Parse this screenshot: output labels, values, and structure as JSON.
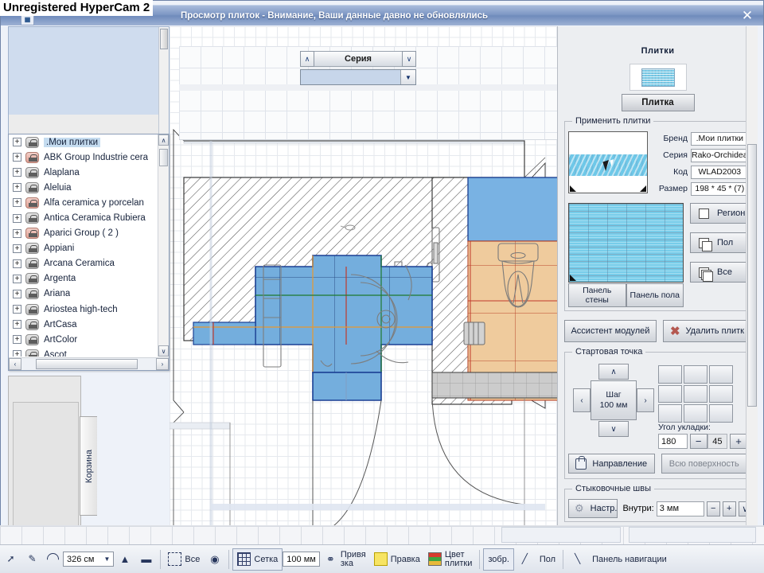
{
  "window": {
    "title": "Просмотр плиток - Внимание, Ваши данные давно не обновлялись",
    "close_label": "✕",
    "watermark": "Unregistered HyperCam 2",
    "app_icon": "tile-app-icon"
  },
  "series_combo": {
    "up_label": "∧",
    "down_label": "∨",
    "main_label": "Серия",
    "value": "",
    "arrow_label": "▼"
  },
  "tree": {
    "items": [
      {
        "label": ".Мои плитки",
        "icon": "folder-icon",
        "variant": "grey",
        "selected": true,
        "expander": "+"
      },
      {
        "label": "ABK Group Industrie cera",
        "icon": "folder-icon",
        "variant": "red",
        "selected": false,
        "expander": "+"
      },
      {
        "label": "Alaplana",
        "icon": "folder-icon",
        "variant": "grey",
        "selected": false,
        "expander": "+"
      },
      {
        "label": "Aleluia",
        "icon": "folder-icon",
        "variant": "grey",
        "selected": false,
        "expander": "+"
      },
      {
        "label": "Alfa ceramica y porcelan",
        "icon": "folder-icon",
        "variant": "red",
        "selected": false,
        "expander": "+"
      },
      {
        "label": "Antica Ceramica Rubiera",
        "icon": "folder-icon",
        "variant": "grey",
        "selected": false,
        "expander": "+"
      },
      {
        "label": "Aparici Group ( 2 )",
        "icon": "folder-icon",
        "variant": "red",
        "selected": false,
        "expander": "+"
      },
      {
        "label": "Appiani",
        "icon": "folder-icon",
        "variant": "grey",
        "selected": false,
        "expander": "+"
      },
      {
        "label": "Arcana Ceramica",
        "icon": "folder-icon",
        "variant": "grey",
        "selected": false,
        "expander": "+"
      },
      {
        "label": "Argenta",
        "icon": "folder-icon",
        "variant": "grey",
        "selected": false,
        "expander": "+"
      },
      {
        "label": "Ariana",
        "icon": "folder-icon",
        "variant": "grey",
        "selected": false,
        "expander": "+"
      },
      {
        "label": "Ariostea high-tech",
        "icon": "folder-icon",
        "variant": "grey",
        "selected": false,
        "expander": "+"
      },
      {
        "label": "ArtCasa",
        "icon": "folder-icon",
        "variant": "grey",
        "selected": false,
        "expander": "+"
      },
      {
        "label": "ArtColor",
        "icon": "folder-icon",
        "variant": "grey",
        "selected": false,
        "expander": "+"
      },
      {
        "label": "Ascot",
        "icon": "folder-icon",
        "variant": "grey",
        "selected": false,
        "expander": "+"
      }
    ],
    "scroll_up": "∧",
    "scroll_down": "∨",
    "scroll_left": "‹",
    "scroll_right": "›"
  },
  "left_dock": {
    "tab_label": "Корзина"
  },
  "right_panel": {
    "title": "Плитки",
    "tile_button": "Плитка",
    "apply_group": "Применить плитки",
    "fields": [
      {
        "label": "Бренд",
        "value": ".Мои плитки"
      },
      {
        "label": "Серия",
        "value": "Rako-Orchidea"
      },
      {
        "label": "Код",
        "value": "WLAD2003"
      },
      {
        "label": "Размер",
        "value": "198 * 45 * (7)"
      }
    ],
    "panel_buttons": [
      {
        "label": "Панель\nстены"
      },
      {
        "label": "Панель пола"
      }
    ],
    "scope_buttons": [
      {
        "label": "Регион",
        "icon": "single-square-icon"
      },
      {
        "label": "Пол",
        "icon": "two-squares-icon"
      },
      {
        "label": "Все",
        "icon": "three-squares-icon"
      }
    ],
    "assistant_button": "Ассистент модулей",
    "delete_button": "Удалить плитк",
    "delete_icon": "red-x-icon",
    "start_point": {
      "legend": "Стартовая точка",
      "up": "∧",
      "down": "∨",
      "left": "‹",
      "right": "›",
      "step_line1": "Шаг",
      "step_line2": "100 мм",
      "angle_label": "Угол укладки:",
      "angle_value": "180",
      "angle_step": "45",
      "minus": "−",
      "plus": "+",
      "direction_button": "Направление",
      "direction_icon": "lock-icon",
      "surface_button": "Всю поверхность"
    },
    "seams": {
      "legend": "Стыковочные швы",
      "settings_button": "Настр.",
      "settings_icon": "gear-icon",
      "inside_label": "Внутри:",
      "inside_value": "3 мм",
      "minus": "−",
      "plus": "+",
      "caret": "∨"
    }
  },
  "bottom_bar": {
    "items": [
      {
        "name": "pointer-tool",
        "icon": "cursor-icon",
        "label": ""
      },
      {
        "name": "measure-tool",
        "icon": "ruler-icon",
        "label": ""
      },
      {
        "name": "rotate-tool",
        "icon": "arc-icon",
        "label": ""
      },
      {
        "name": "zoom-value",
        "icon": "",
        "label": "326 см"
      },
      {
        "name": "zoom-in",
        "icon": "plus-icon",
        "label": ""
      },
      {
        "name": "zoom-out",
        "icon": "minus-icon",
        "label": ""
      },
      {
        "name": "select-all",
        "icon": "select-icon",
        "label": "Все"
      },
      {
        "name": "target-tool",
        "icon": "target-icon",
        "label": ""
      },
      {
        "name": "grid-toggle",
        "icon": "grid-icon",
        "label": "Сетка"
      },
      {
        "name": "grid-size",
        "icon": "",
        "label": "100 мм"
      },
      {
        "name": "snap-tool",
        "icon": "magnet-icon",
        "label": "Привя\nзка"
      },
      {
        "name": "edit-tool",
        "icon": "edit-icon",
        "label": "Правка"
      },
      {
        "name": "tile-color",
        "icon": "color-icon",
        "label": "Цвет\nплитки"
      },
      {
        "name": "image-tool",
        "icon": "",
        "label": "зобр."
      },
      {
        "name": "pen-tool",
        "icon": "pen-icon",
        "label": ""
      },
      {
        "name": "floor-tool",
        "icon": "",
        "label": "Пол"
      },
      {
        "name": "line-tool",
        "icon": "line-icon",
        "label": ""
      },
      {
        "name": "nav-panel",
        "icon": "",
        "label": "Панель навигации"
      }
    ]
  },
  "plan": {
    "description": "bathroom-floor-plan",
    "colors": {
      "wall_hatch": "#6a6a6a",
      "blue_tile": "#6fa9dc",
      "blue_tile_dark": "#5f9ad2",
      "beige_tile": "#eec89a",
      "grey_tile": "#c9c9c9",
      "outline_blue": "#1b3fa0",
      "outline_red": "#c0392b",
      "grid": "#c9cfd8"
    }
  }
}
